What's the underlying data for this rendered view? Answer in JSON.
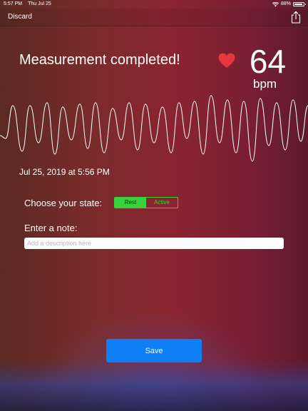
{
  "status_bar": {
    "time": "5:57 PM",
    "date": "Thu Jul 25",
    "battery": "88%"
  },
  "nav": {
    "discard_label": "Discard",
    "share_icon": "share-icon"
  },
  "result": {
    "headline": "Measurement completed!",
    "bpm_value": "64",
    "bpm_unit": "bpm",
    "heart_color": "#e8363f",
    "timestamp": "Jul 25, 2019 at 5:56 PM"
  },
  "form": {
    "state_label": "Choose your state:",
    "state_options": [
      "Rest",
      "Active"
    ],
    "selected_state": "Rest",
    "state_color": "#3ad13f",
    "note_label": "Enter a note:",
    "note_placeholder": "Add a description here",
    "note_value": ""
  },
  "actions": {
    "save_label": "Save",
    "save_color": "#0f7ff6"
  }
}
